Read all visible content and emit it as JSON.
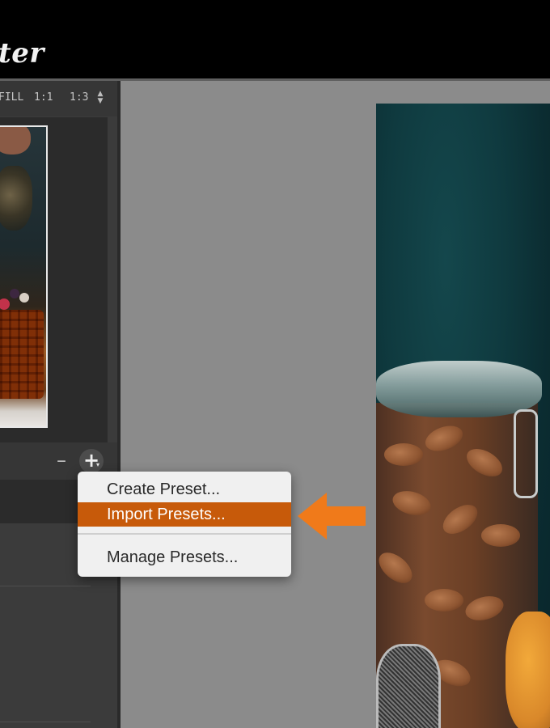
{
  "app": {
    "title_fragment": "ter"
  },
  "navigator": {
    "zoom_options": [
      "FILL",
      "1:1",
      "1:3"
    ],
    "stepper_up": "▲",
    "stepper_down": "▼"
  },
  "presets": {
    "minus_label": "–",
    "plus_label": "+",
    "plus_caret": "▾"
  },
  "context_menu": {
    "items": [
      {
        "label": "Create Preset..."
      },
      {
        "label": "Import Presets..."
      },
      {
        "label": "Manage Presets..."
      }
    ],
    "selected_index": 1
  },
  "colors": {
    "accent_orange": "#c75a0a",
    "arrow_orange": "#f07a1a",
    "panel_dark": "#3b3b3b",
    "canvas_gray": "#8b8b8b",
    "menu_bg": "#f0f0f0"
  },
  "icons": {
    "arrow": "arrow-left-icon",
    "plus": "plus-icon",
    "minus": "minus-icon",
    "stepper": "stepper-icon"
  }
}
